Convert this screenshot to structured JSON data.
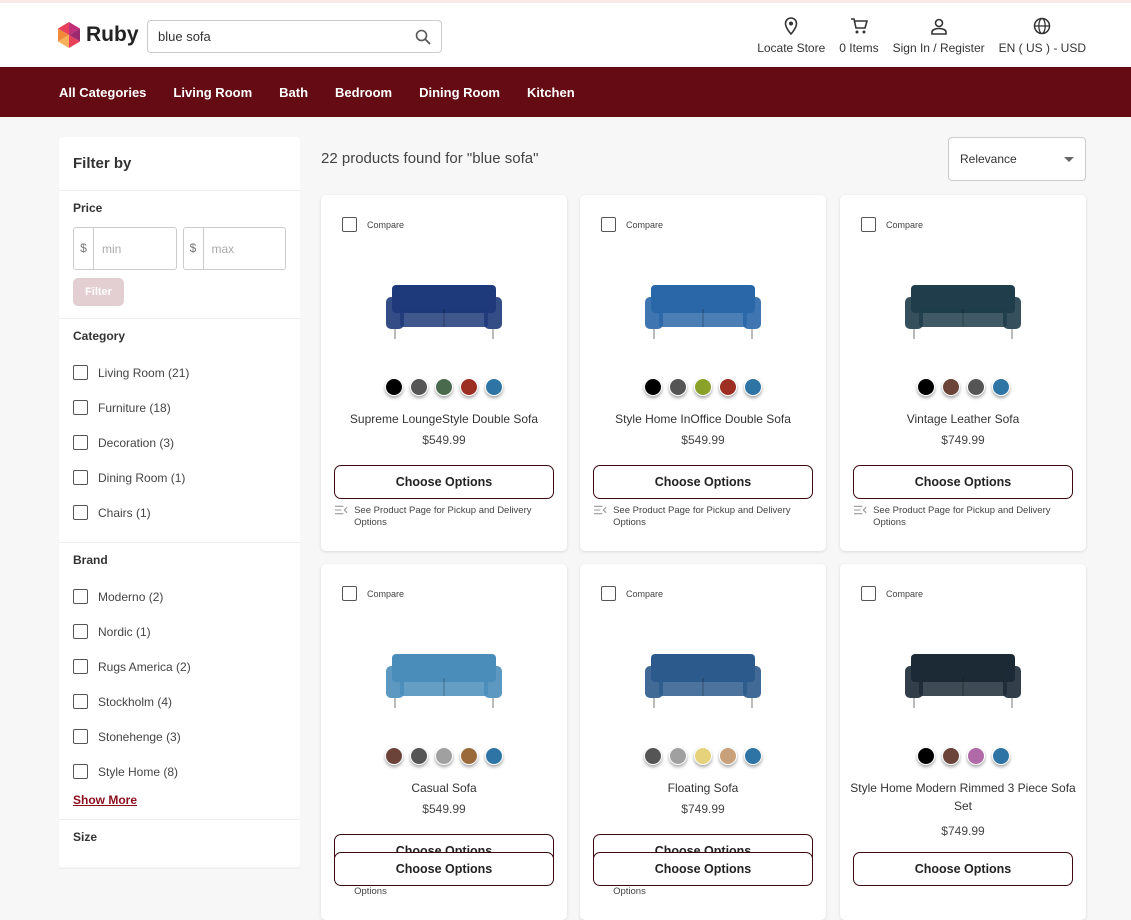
{
  "header": {
    "brand": "Ruby",
    "search_value": "blue sofa",
    "items": [
      {
        "icon": "location-icon",
        "label": "Locate Store"
      },
      {
        "icon": "cart-icon",
        "label": "0 Items"
      },
      {
        "icon": "user-icon",
        "label": "Sign In / Register"
      },
      {
        "icon": "globe-icon",
        "label": "EN ( US ) - USD"
      }
    ]
  },
  "nav": [
    "All Categories",
    "Living Room",
    "Bath",
    "Bedroom",
    "Dining Room",
    "Kitchen"
  ],
  "filter": {
    "title": "Filter by",
    "price_label": "Price",
    "currency": "$",
    "min_placeholder": "min",
    "max_placeholder": "max",
    "filter_button": "Filter",
    "category_label": "Category",
    "categories": [
      "Living Room (21)",
      "Furniture (18)",
      "Decoration (3)",
      "Dining Room (1)",
      "Chairs (1)"
    ],
    "brand_label": "Brand",
    "brands": [
      "Moderno (2)",
      "Nordic (1)",
      "Rugs America (2)",
      "Stockholm (4)",
      "Stonehenge (3)",
      "Style Home (8)"
    ],
    "show_more": "Show More",
    "size_label": "Size"
  },
  "results_text": "22 products found for \"blue sofa\"",
  "sort": "Relevance",
  "card_labels": {
    "compare": "Compare",
    "choose": "Choose Options",
    "note": "See Product Page for Pickup and Delivery Options"
  },
  "products": [
    {
      "name": "Supreme LoungeStyle Double Sofa",
      "price": "$549.99",
      "sofa": "#1f3a7a",
      "colors": [
        "#000000",
        "#555555",
        "#4a6a4e",
        "#9c2f22",
        "#2e74a4"
      ]
    },
    {
      "name": "Style Home InOffice Double Sofa",
      "price": "$549.99",
      "sofa": "#2a67a8",
      "colors": [
        "#000000",
        "#555555",
        "#8aa22a",
        "#9c2f22",
        "#2e74a4"
      ]
    },
    {
      "name": "Vintage Leather Sofa",
      "price": "$749.99",
      "sofa": "#1f3d4a",
      "colors": [
        "#000000",
        "#6b4338",
        "#555555",
        "#2e74a4"
      ]
    },
    {
      "name": "Casual Sofa",
      "price": "$549.99",
      "sofa": "#4a8dbb",
      "colors": [
        "#6b4338",
        "#555555",
        "#a0a0a0",
        "#9a6a3a",
        "#2e74a4"
      ]
    },
    {
      "name": "Floating Sofa",
      "price": "$749.99",
      "sofa": "#2c5a8c",
      "colors": [
        "#555555",
        "#a0a0a0",
        "#e6d27a",
        "#c8a07a",
        "#2e74a4"
      ]
    },
    {
      "name": "Style Home Modern Rimmed 3 Piece Sofa Set",
      "price": "$749.99",
      "sofa": "#1c2a36",
      "colors": [
        "#000000",
        "#6b4338",
        "#b06aa8",
        "#2e74a4"
      ]
    }
  ]
}
